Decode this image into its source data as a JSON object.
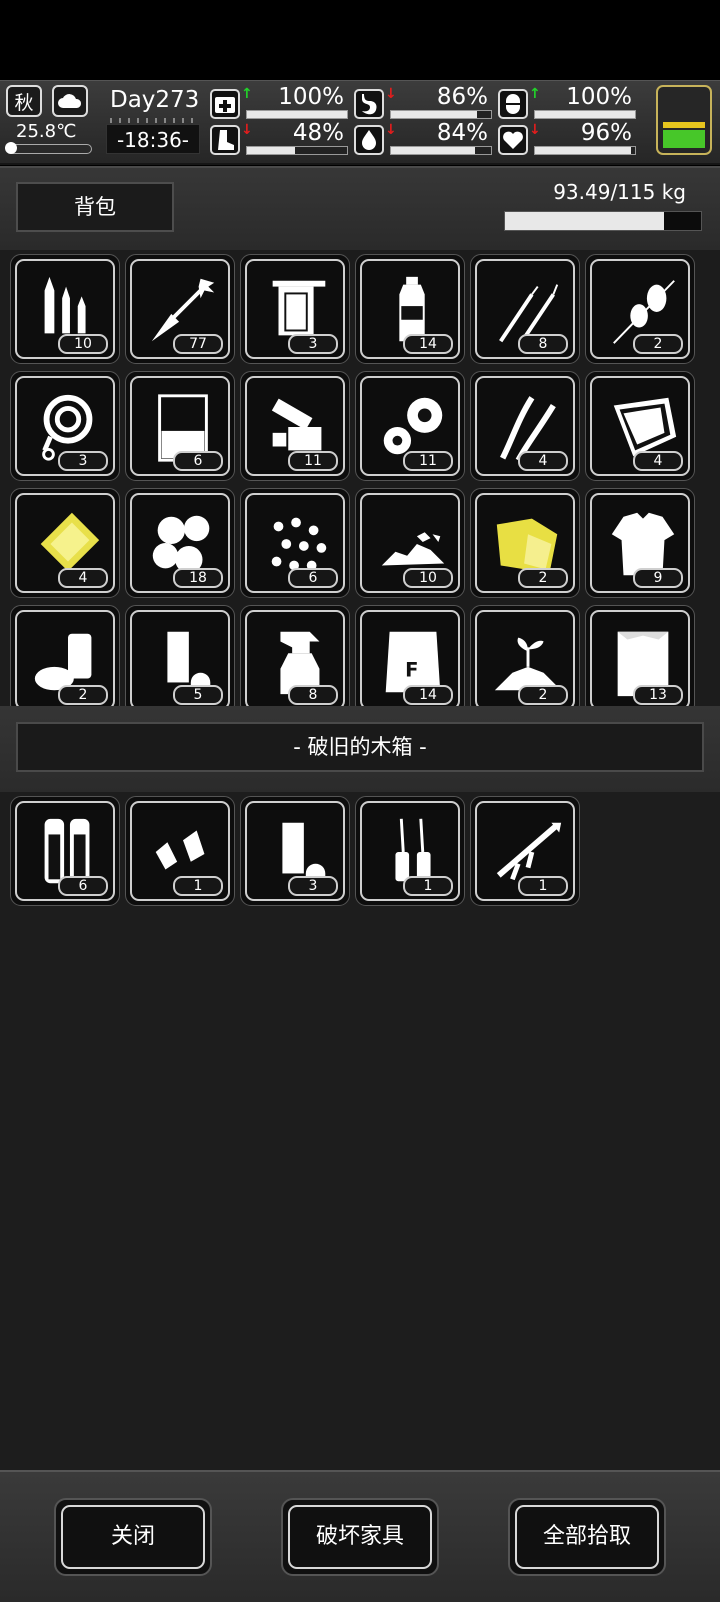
{
  "status": {
    "season": "秋",
    "weather_icon": "cloud-icon",
    "temperature": "25.8℃",
    "day": "Day273",
    "time": "-18:36-",
    "stats": [
      {
        "name": "health",
        "icon": "medkit-icon",
        "trend": "up",
        "value": "100%",
        "level": 1.0
      },
      {
        "name": "hunger",
        "icon": "stomach-icon",
        "trend": "down",
        "value": "86%",
        "level": 0.86
      },
      {
        "name": "sanity",
        "icon": "pill-icon",
        "trend": "up",
        "value": "100%",
        "level": 1.0
      },
      {
        "name": "stamina",
        "icon": "boot-icon",
        "trend": "down",
        "value": "48%",
        "level": 0.48
      },
      {
        "name": "thirst",
        "icon": "water-drop-icon",
        "trend": "down",
        "value": "84%",
        "level": 0.84
      },
      {
        "name": "mood",
        "icon": "heart-icon",
        "trend": "down",
        "value": "96%",
        "level": 0.96
      }
    ],
    "battery_icon": "battery-icon"
  },
  "backpack": {
    "title": "背包",
    "weight": "93.49/115 kg",
    "weight_fraction": 0.813,
    "items": [
      {
        "icon": "bullets-icon",
        "count": "10"
      },
      {
        "icon": "arrow-icon",
        "count": "77"
      },
      {
        "icon": "towel-icon",
        "count": "3"
      },
      {
        "icon": "water-bottle-icon",
        "count": "14"
      },
      {
        "icon": "lockpick-icon",
        "count": "8"
      },
      {
        "icon": "skewer-icon",
        "count": "2"
      },
      {
        "icon": "rope-icon",
        "count": "3"
      },
      {
        "icon": "beaker-icon",
        "count": "6"
      },
      {
        "icon": "scrap-parts-icon",
        "count": "11"
      },
      {
        "icon": "gears-icon",
        "count": "11"
      },
      {
        "icon": "wires-icon",
        "count": "4"
      },
      {
        "icon": "plastic-sheet-icon",
        "count": "4"
      },
      {
        "icon": "metal-plate-icon",
        "count": "4"
      },
      {
        "icon": "cotton-icon",
        "count": "18"
      },
      {
        "icon": "beads-icon",
        "count": "6"
      },
      {
        "icon": "rubble-icon",
        "count": "10"
      },
      {
        "icon": "cloth-icon",
        "count": "2"
      },
      {
        "icon": "torn-shirt-icon",
        "count": "9"
      },
      {
        "icon": "cans-icon",
        "count": "2"
      },
      {
        "icon": "shell-casing-icon",
        "count": "5"
      },
      {
        "icon": "spray-bottle-icon",
        "count": "8"
      },
      {
        "icon": "fertilizer-bag-icon",
        "count": "14"
      },
      {
        "icon": "soil-sprout-icon",
        "count": "2"
      },
      {
        "icon": "sack-icon",
        "count": "13"
      }
    ]
  },
  "container": {
    "title": "- 破旧的木箱 -",
    "items": [
      {
        "icon": "rifle-cartridges-icon",
        "count": "6"
      },
      {
        "icon": "bullet-heads-icon",
        "count": "1"
      },
      {
        "icon": "shell-casing-icon",
        "count": "3"
      },
      {
        "icon": "ampoules-icon",
        "count": "1"
      },
      {
        "icon": "rocket-launcher-icon",
        "count": "1"
      }
    ]
  },
  "buttons": {
    "close": "关闭",
    "break_furniture": "破坏家具",
    "take_all": "全部拾取"
  }
}
